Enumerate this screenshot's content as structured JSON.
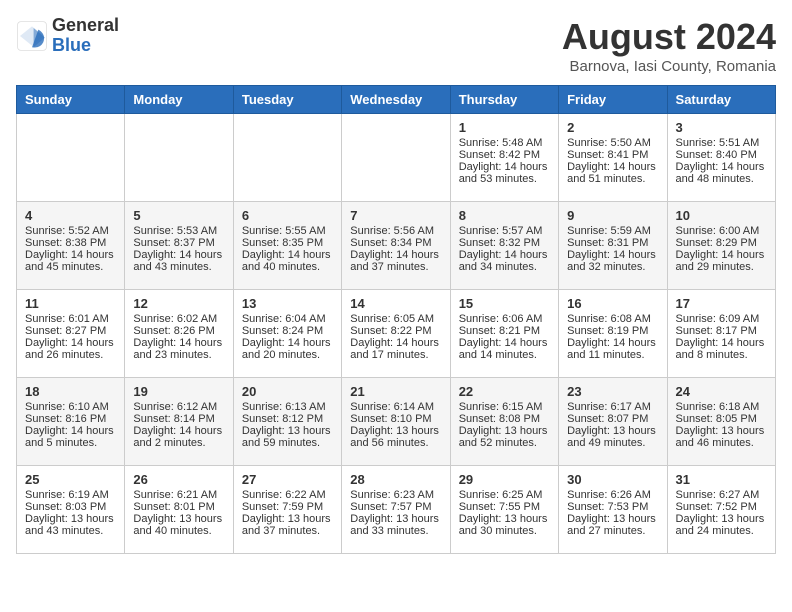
{
  "header": {
    "logo_general": "General",
    "logo_blue": "Blue",
    "main_title": "August 2024",
    "subtitle": "Barnova, Iasi County, Romania"
  },
  "weekdays": [
    "Sunday",
    "Monday",
    "Tuesday",
    "Wednesday",
    "Thursday",
    "Friday",
    "Saturday"
  ],
  "weeks": [
    [
      {
        "day": "",
        "info": ""
      },
      {
        "day": "",
        "info": ""
      },
      {
        "day": "",
        "info": ""
      },
      {
        "day": "",
        "info": ""
      },
      {
        "day": "1",
        "info": "Sunrise: 5:48 AM\nSunset: 8:42 PM\nDaylight: 14 hours\nand 53 minutes."
      },
      {
        "day": "2",
        "info": "Sunrise: 5:50 AM\nSunset: 8:41 PM\nDaylight: 14 hours\nand 51 minutes."
      },
      {
        "day": "3",
        "info": "Sunrise: 5:51 AM\nSunset: 8:40 PM\nDaylight: 14 hours\nand 48 minutes."
      }
    ],
    [
      {
        "day": "4",
        "info": "Sunrise: 5:52 AM\nSunset: 8:38 PM\nDaylight: 14 hours\nand 45 minutes."
      },
      {
        "day": "5",
        "info": "Sunrise: 5:53 AM\nSunset: 8:37 PM\nDaylight: 14 hours\nand 43 minutes."
      },
      {
        "day": "6",
        "info": "Sunrise: 5:55 AM\nSunset: 8:35 PM\nDaylight: 14 hours\nand 40 minutes."
      },
      {
        "day": "7",
        "info": "Sunrise: 5:56 AM\nSunset: 8:34 PM\nDaylight: 14 hours\nand 37 minutes."
      },
      {
        "day": "8",
        "info": "Sunrise: 5:57 AM\nSunset: 8:32 PM\nDaylight: 14 hours\nand 34 minutes."
      },
      {
        "day": "9",
        "info": "Sunrise: 5:59 AM\nSunset: 8:31 PM\nDaylight: 14 hours\nand 32 minutes."
      },
      {
        "day": "10",
        "info": "Sunrise: 6:00 AM\nSunset: 8:29 PM\nDaylight: 14 hours\nand 29 minutes."
      }
    ],
    [
      {
        "day": "11",
        "info": "Sunrise: 6:01 AM\nSunset: 8:27 PM\nDaylight: 14 hours\nand 26 minutes."
      },
      {
        "day": "12",
        "info": "Sunrise: 6:02 AM\nSunset: 8:26 PM\nDaylight: 14 hours\nand 23 minutes."
      },
      {
        "day": "13",
        "info": "Sunrise: 6:04 AM\nSunset: 8:24 PM\nDaylight: 14 hours\nand 20 minutes."
      },
      {
        "day": "14",
        "info": "Sunrise: 6:05 AM\nSunset: 8:22 PM\nDaylight: 14 hours\nand 17 minutes."
      },
      {
        "day": "15",
        "info": "Sunrise: 6:06 AM\nSunset: 8:21 PM\nDaylight: 14 hours\nand 14 minutes."
      },
      {
        "day": "16",
        "info": "Sunrise: 6:08 AM\nSunset: 8:19 PM\nDaylight: 14 hours\nand 11 minutes."
      },
      {
        "day": "17",
        "info": "Sunrise: 6:09 AM\nSunset: 8:17 PM\nDaylight: 14 hours\nand 8 minutes."
      }
    ],
    [
      {
        "day": "18",
        "info": "Sunrise: 6:10 AM\nSunset: 8:16 PM\nDaylight: 14 hours\nand 5 minutes."
      },
      {
        "day": "19",
        "info": "Sunrise: 6:12 AM\nSunset: 8:14 PM\nDaylight: 14 hours\nand 2 minutes."
      },
      {
        "day": "20",
        "info": "Sunrise: 6:13 AM\nSunset: 8:12 PM\nDaylight: 13 hours\nand 59 minutes."
      },
      {
        "day": "21",
        "info": "Sunrise: 6:14 AM\nSunset: 8:10 PM\nDaylight: 13 hours\nand 56 minutes."
      },
      {
        "day": "22",
        "info": "Sunrise: 6:15 AM\nSunset: 8:08 PM\nDaylight: 13 hours\nand 52 minutes."
      },
      {
        "day": "23",
        "info": "Sunrise: 6:17 AM\nSunset: 8:07 PM\nDaylight: 13 hours\nand 49 minutes."
      },
      {
        "day": "24",
        "info": "Sunrise: 6:18 AM\nSunset: 8:05 PM\nDaylight: 13 hours\nand 46 minutes."
      }
    ],
    [
      {
        "day": "25",
        "info": "Sunrise: 6:19 AM\nSunset: 8:03 PM\nDaylight: 13 hours\nand 43 minutes."
      },
      {
        "day": "26",
        "info": "Sunrise: 6:21 AM\nSunset: 8:01 PM\nDaylight: 13 hours\nand 40 minutes."
      },
      {
        "day": "27",
        "info": "Sunrise: 6:22 AM\nSunset: 7:59 PM\nDaylight: 13 hours\nand 37 minutes."
      },
      {
        "day": "28",
        "info": "Sunrise: 6:23 AM\nSunset: 7:57 PM\nDaylight: 13 hours\nand 33 minutes."
      },
      {
        "day": "29",
        "info": "Sunrise: 6:25 AM\nSunset: 7:55 PM\nDaylight: 13 hours\nand 30 minutes."
      },
      {
        "day": "30",
        "info": "Sunrise: 6:26 AM\nSunset: 7:53 PM\nDaylight: 13 hours\nand 27 minutes."
      },
      {
        "day": "31",
        "info": "Sunrise: 6:27 AM\nSunset: 7:52 PM\nDaylight: 13 hours\nand 24 minutes."
      }
    ]
  ]
}
